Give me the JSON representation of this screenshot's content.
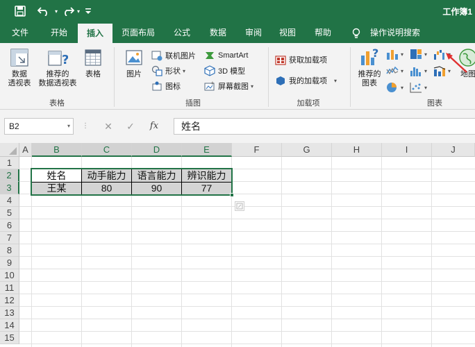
{
  "window": {
    "title": "工作簿1"
  },
  "ribbon_tabs": [
    "文件",
    "开始",
    "插入",
    "页面布局",
    "公式",
    "数据",
    "审阅",
    "视图",
    "帮助",
    "操作说明搜索"
  ],
  "active_tab": "插入",
  "groups": {
    "tables": {
      "label": "表格",
      "pivot": "数据\n透视表",
      "recommended_pivot": "推荐的\n数据透视表",
      "table": "表格"
    },
    "illustrations": {
      "label": "插图",
      "picture": "图片",
      "online_pictures": "联机图片",
      "shapes": "形状",
      "icons": "图标",
      "smartart": "SmartArt",
      "model3d": "3D 模型",
      "screenshot": "屏幕截图"
    },
    "addins": {
      "label": "加载项",
      "get_addins": "获取加载项",
      "my_addins": "我的加载项"
    },
    "charts": {
      "label": "图表",
      "recommended": "推荐的\n图表",
      "maps": "地图"
    }
  },
  "formula_bar": {
    "name_box": "B2",
    "fx": "fx",
    "formula": "姓名"
  },
  "columns": [
    "A",
    "B",
    "C",
    "D",
    "E",
    "F",
    "G",
    "H",
    "I",
    "J"
  ],
  "selected_columns": [
    "B",
    "C",
    "D",
    "E"
  ],
  "rows": [
    "1",
    "2",
    "3",
    "4",
    "5",
    "6",
    "7",
    "8",
    "9",
    "10",
    "11",
    "12",
    "13",
    "14",
    "15"
  ],
  "selected_rows": [
    "2",
    "3"
  ],
  "table": {
    "headers": [
      "姓名",
      "动手能力",
      "语言能力",
      "辨识能力"
    ],
    "row": [
      "王某",
      "80",
      "90",
      "77"
    ]
  },
  "colors": {
    "brand": "#217346",
    "arrow": "#e03030"
  }
}
